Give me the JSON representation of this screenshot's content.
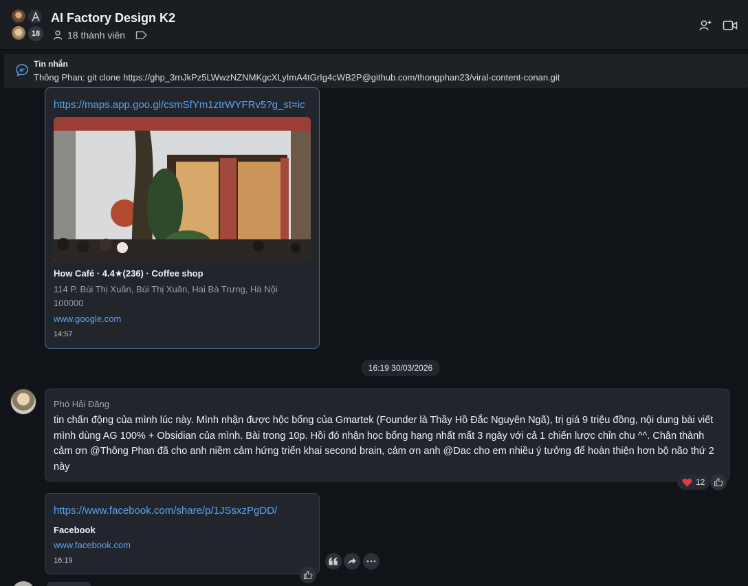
{
  "header": {
    "title": "AI Factory Design K2",
    "member_count_badge": "18",
    "members_label": "18 thành viên"
  },
  "pinned": {
    "title": "Tin nhắn",
    "text": "Thông Phan: git clone https://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@github.com/thongphan23/viral-content-conan.git"
  },
  "place_card": {
    "url": "https://maps.app.goo.gl/csmSfYm1ztrWYFRv5?g_st=ic",
    "title": "How Café · 4.4★(236) · Coffee shop",
    "address_line1": "114 P. Bùi Thị Xuân, Bùi Thị Xuân, Hai Bà Trưng, Hà Nội",
    "address_line2": "100000",
    "domain": "www.google.com",
    "time": "14:57"
  },
  "date_separator": "16:19 30/03/2026",
  "message": {
    "sender": "Phó Hải Đăng",
    "text": "tin chấn động của mình lúc này. Mình nhận được hộc bổng của Gmartek (Founder là Thầy Hồ Đắc Nguyên Ngã), trị giá 9 triệu đồng, nội dung bài viết mình dùng AG 100% + Obsidian của mình. Bài trong 10p. Hồi đó nhận học bổng hạng nhất mất 3 ngày với cả 1 chiến lược chỉn chu ^^. Chân thành cảm ơn @Thông Phan đã cho anh niềm cảm hứng triển khai second brain, cảm ơn anh @Dac cho em nhiều ý tưởng để hoàn thiện hơn bộ não thứ 2 này",
    "reaction_count": "12",
    "reaction_icon": "heart"
  },
  "fb_card": {
    "url": "https://www.facebook.com/share/p/1JSsxzPgDD/",
    "title": "Facebook",
    "domain": "www.facebook.com",
    "time": "16:19"
  },
  "colors": {
    "background": "#101317",
    "header": "#1a1d22",
    "card": "#22262c",
    "link": "#5aa2f0",
    "accent_border": "#4a6fa5"
  }
}
